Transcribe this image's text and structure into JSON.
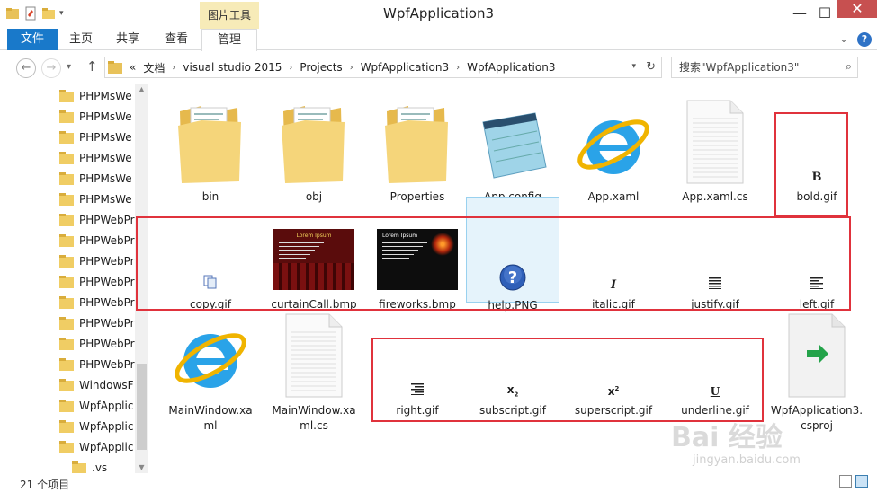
{
  "window": {
    "title": "WpfApplication3",
    "context_tab_header": "图片工具",
    "minimize": "—",
    "maximize": "☐",
    "close": "✕"
  },
  "ribbon": {
    "tabs": [
      {
        "label": "文件"
      },
      {
        "label": "主页"
      },
      {
        "label": "共享"
      },
      {
        "label": "查看"
      },
      {
        "label": "管理"
      }
    ]
  },
  "address": {
    "prefix": "«",
    "segments": [
      "文档",
      "visual studio 2015",
      "Projects",
      "WpfApplication3",
      "WpfApplication3"
    ]
  },
  "search": {
    "placeholder": "搜索\"WpfApplication3\""
  },
  "navpane": {
    "items": [
      {
        "label": "PHPMsWe"
      },
      {
        "label": "PHPMsWe"
      },
      {
        "label": "PHPMsWe"
      },
      {
        "label": "PHPMsWe"
      },
      {
        "label": "PHPMsWe"
      },
      {
        "label": "PHPMsWe"
      },
      {
        "label": "PHPWebPr"
      },
      {
        "label": "PHPWebPr"
      },
      {
        "label": "PHPWebPr"
      },
      {
        "label": "PHPWebPr"
      },
      {
        "label": "PHPWebPr"
      },
      {
        "label": "PHPWebPr"
      },
      {
        "label": "PHPWebPr"
      },
      {
        "label": "PHPWebPr"
      },
      {
        "label": "WindowsF"
      },
      {
        "label": "WpfApplic"
      },
      {
        "label": "WpfApplic"
      },
      {
        "label": "WpfApplic"
      },
      {
        "label": ".vs"
      }
    ]
  },
  "files": [
    {
      "name": "bin",
      "icon": "folder-icon"
    },
    {
      "name": "obj",
      "icon": "folder-icon"
    },
    {
      "name": "Properties",
      "icon": "folder-icon"
    },
    {
      "name": "App.config",
      "icon": "notepad-icon"
    },
    {
      "name": "App.xaml",
      "icon": "ie-icon"
    },
    {
      "name": "App.xaml.cs",
      "icon": "document-icon"
    },
    {
      "name": "bold.gif",
      "icon": "bold-icon",
      "glyph": "B"
    },
    {
      "name": "copy.gif",
      "icon": "copy-icon"
    },
    {
      "name": "curtainCall.bmp",
      "icon": "slide-thumbnail",
      "slide_title": "Lorem Ipsum"
    },
    {
      "name": "fireworks.bmp",
      "icon": "slide-thumbnail",
      "slide_title": "Lorem Ipsum"
    },
    {
      "name": "help.PNG",
      "icon": "help-icon",
      "glyph": "?"
    },
    {
      "name": "italic.gif",
      "icon": "italic-icon",
      "glyph": "I"
    },
    {
      "name": "justify.gif",
      "icon": "justify-icon"
    },
    {
      "name": "left.gif",
      "icon": "align-left-icon"
    },
    {
      "name": "MainWindow.xaml",
      "icon": "ie-icon"
    },
    {
      "name": "MainWindow.xaml.cs",
      "icon": "document-icon"
    },
    {
      "name": "right.gif",
      "icon": "align-right-icon"
    },
    {
      "name": "subscript.gif",
      "icon": "subscript-icon",
      "glyph": "x",
      "sub": "2"
    },
    {
      "name": "superscript.gif",
      "icon": "superscript-icon",
      "glyph": "x",
      "sup": "2"
    },
    {
      "name": "underline.gif",
      "icon": "underline-icon",
      "glyph": "U"
    },
    {
      "name": "WpfApplication3.csproj",
      "icon": "csproj-icon"
    }
  ],
  "selected_file": "help.PNG",
  "status": {
    "count": "21 个项目"
  },
  "watermark": {
    "text": "Bai 经验",
    "url": "jingyan.baidu.com"
  },
  "colors": {
    "accent": "#1979ca",
    "highlight_box": "#e0323c",
    "selection": "#e5f3fb",
    "folder": "#f5d57a",
    "close_button": "#c75050"
  }
}
